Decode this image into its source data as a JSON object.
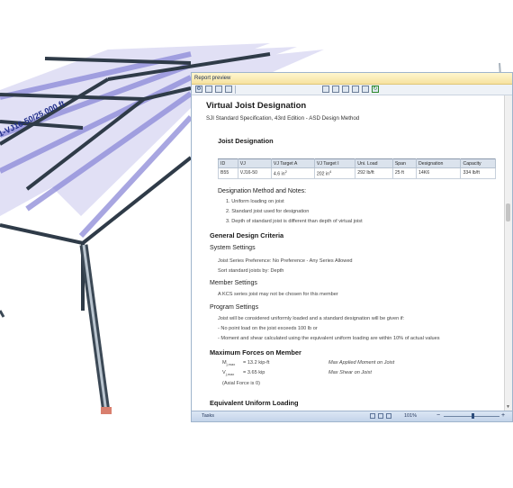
{
  "model_view": {
    "member_label": "1-VJ16-50/25.000 ft"
  },
  "window": {
    "title": "Report preview"
  },
  "toolbar": {
    "icons": [
      "settings-icon",
      "save-icon",
      "print-icon",
      "export-icon",
      "zoom-out-icon",
      "zoom-in-icon",
      "page-first-icon",
      "page-last-icon",
      "page-view-icon",
      "refresh-icon"
    ]
  },
  "report": {
    "title": "Virtual Joist Designation",
    "subtitle": "SJI Standard Specification, 43rd Edition - ASD Design Method",
    "joist_section": "Joist Designation",
    "table": {
      "headers": [
        "ID",
        "VJ",
        "VJ Target A",
        "VJ Target I",
        "Uni. Load",
        "Span",
        "Designation",
        "Capacity"
      ],
      "rows": [
        {
          "id": "B55",
          "vj": "VJ16-50",
          "target_a": "4.6 in",
          "target_a_sup": "2",
          "target_i": "202 in",
          "target_i_sup": "4",
          "load": "292 lb/ft",
          "span": "25 ft",
          "designation": "14K6",
          "capacity": "334 lb/ft"
        }
      ]
    },
    "method_heading": "Designation Method and Notes:",
    "notes": [
      "1. Uniform loading on joist",
      "2. Standard joist used for designation",
      "3. Depth of standard joist is different than depth of virtual joist"
    ],
    "general_heading": "General Design Criteria",
    "system_heading": "System Settings",
    "system_lines": [
      "Joist Series Preference: No Preference - Any Series Allowed",
      "Sort standard joists by: Depth"
    ],
    "member_heading": "Member Settings",
    "member_line": "A KCS series joist may not be chosen for this member",
    "program_heading": "Program Settings",
    "program_lines": [
      "Joist will be considered uniformly loaded and a standard designation will be given if:",
      "- No point load on the joist exceeds 100 lb or",
      "- Moment and shear calculated using the equivalent uniform loading are within 10% of actual values"
    ],
    "forces_heading": "Maximum Forces on Member",
    "forces": [
      {
        "sym": "M",
        "sub": "j,max",
        "value": "= 13.2 kip-ft",
        "desc": "Max Applied Moment on Joist"
      },
      {
        "sym": "V",
        "sub": "j,max",
        "value": "= 3.65 kip",
        "desc": "Max Shear on Joist"
      }
    ],
    "axial_note": "(Axial Force is 0)",
    "equiv_heading": "Equivalent Uniform Loading"
  },
  "status_bar": {
    "tasks": "Tasks",
    "zoom": "101%"
  }
}
